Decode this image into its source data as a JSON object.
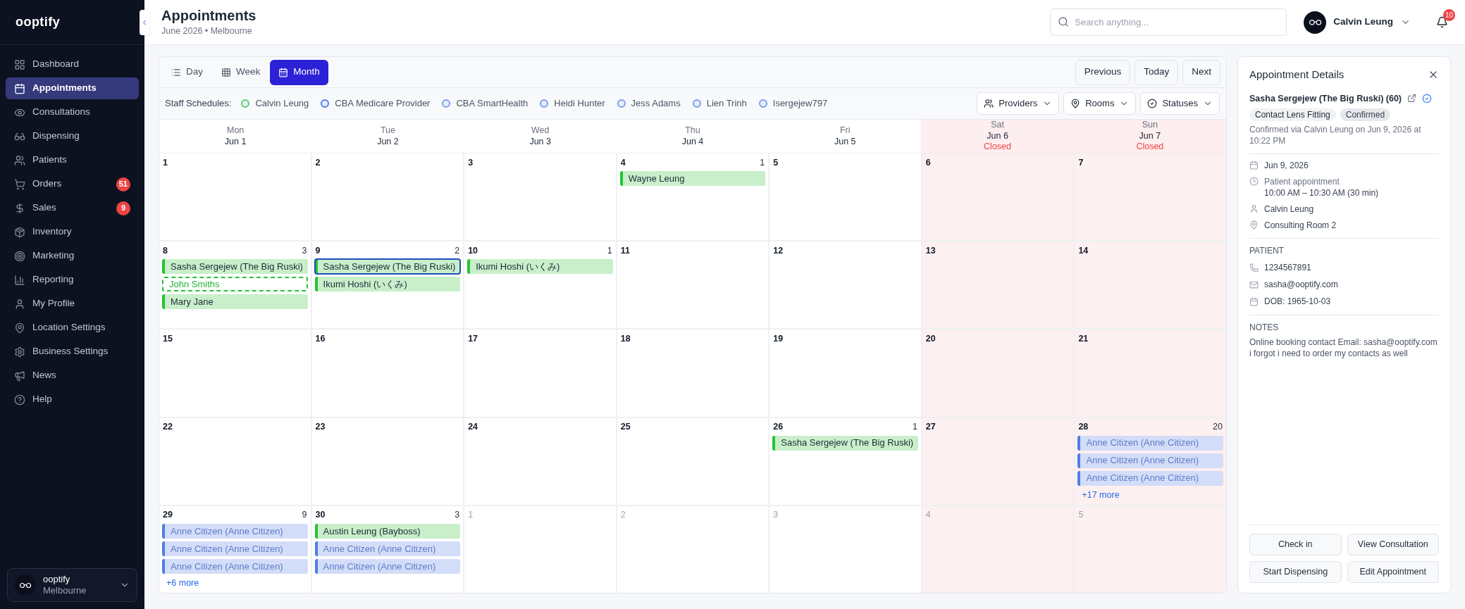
{
  "sidebar": {
    "logo": "ooptify",
    "items": [
      {
        "label": "Dashboard",
        "selected": false
      },
      {
        "label": "Appointments",
        "selected": true
      },
      {
        "label": "Consultations",
        "selected": false
      },
      {
        "label": "Dispensing",
        "selected": false
      },
      {
        "label": "Patients",
        "selected": false
      },
      {
        "label": "Orders",
        "selected": false,
        "badge": "51"
      },
      {
        "label": "Sales",
        "selected": false,
        "badge": "9"
      },
      {
        "label": "Inventory",
        "selected": false
      },
      {
        "label": "Marketing",
        "selected": false
      },
      {
        "label": "Reporting",
        "selected": false
      },
      {
        "label": "My Profile",
        "selected": false
      },
      {
        "label": "Location Settings",
        "selected": false
      },
      {
        "label": "Business Settings",
        "selected": false
      },
      {
        "label": "News",
        "selected": false
      },
      {
        "label": "Help",
        "selected": false
      }
    ],
    "account": {
      "name": "ooptify",
      "location": "Melbourne"
    }
  },
  "header": {
    "title": "Appointments",
    "subtitle": "June 2026 • Melbourne",
    "search": {
      "placeholder": "Search anything..."
    },
    "user": "Calvin Leung",
    "notifications": "10"
  },
  "calendar": {
    "views": [
      {
        "label": "Day",
        "selected": false
      },
      {
        "label": "Week",
        "selected": false
      },
      {
        "label": "Month",
        "selected": true
      }
    ],
    "nav": [
      "Previous",
      "Today",
      "Next"
    ],
    "staff_label": "Staff Schedules:",
    "staff": [
      {
        "name": "Calvin Leung",
        "color": "#5fd06a"
      },
      {
        "name": "CBA Medicare Provider",
        "color": "#4f7ee8"
      },
      {
        "name": "CBA SmartHealth",
        "color": "#7d9ef0"
      },
      {
        "name": "Heidi Hunter",
        "color": "#7d9ef0"
      },
      {
        "name": "Jess Adams",
        "color": "#7d9ef0"
      },
      {
        "name": "Lien Trinh",
        "color": "#7d9ef0"
      },
      {
        "name": "Isergejew797",
        "color": "#7d9ef0"
      }
    ],
    "filters": [
      "Providers",
      "Rooms",
      "Statuses"
    ],
    "weekdays": [
      {
        "day": "Mon",
        "date": "Jun 1",
        "closed": false
      },
      {
        "day": "Tue",
        "date": "Jun 2",
        "closed": false
      },
      {
        "day": "Wed",
        "date": "Jun 3",
        "closed": false
      },
      {
        "day": "Thu",
        "date": "Jun 4",
        "closed": false
      },
      {
        "day": "Fri",
        "date": "Jun 5",
        "closed": false
      },
      {
        "day": "Sat",
        "date": "Jun 6",
        "closed": true,
        "note": "Closed"
      },
      {
        "day": "Sun",
        "date": "Jun 7",
        "closed": true,
        "note": "Closed"
      }
    ],
    "days": [
      {
        "number": "1",
        "outside_month": false
      },
      {
        "number": "2",
        "outside_month": false
      },
      {
        "number": "3",
        "outside_month": false
      },
      {
        "number": "4",
        "outside_month": false,
        "count": "1",
        "events": [
          {
            "name": "Wayne Leung",
            "kind": "booked",
            "selected": false
          }
        ]
      },
      {
        "number": "5",
        "outside_month": false
      },
      {
        "number": "6",
        "outside_month": false
      },
      {
        "number": "7",
        "outside_month": false
      },
      {
        "number": "8",
        "outside_month": false,
        "count": "3",
        "events": [
          {
            "name": "Sasha Sergejew (The Big Ruski)",
            "kind": "booked",
            "selected": false
          },
          {
            "name": "John Smiths",
            "kind": "unconfirmed",
            "selected": false
          },
          {
            "name": "Mary Jane",
            "kind": "booked",
            "selected": false
          }
        ]
      },
      {
        "number": "9",
        "outside_month": false,
        "count": "2",
        "events": [
          {
            "name": "Sasha Sergejew (The Big Ruski)",
            "kind": "booked",
            "selected": true
          },
          {
            "name": "Ikumi Hoshi (いくみ)",
            "kind": "booked",
            "selected": false
          }
        ]
      },
      {
        "number": "10",
        "outside_month": false,
        "count": "1",
        "events": [
          {
            "name": "Ikumi Hoshi (いくみ)",
            "kind": "booked",
            "selected": false
          }
        ]
      },
      {
        "number": "11",
        "outside_month": false
      },
      {
        "number": "12",
        "outside_month": false
      },
      {
        "number": "13",
        "outside_month": false
      },
      {
        "number": "14",
        "outside_month": false
      },
      {
        "number": "15",
        "outside_month": false
      },
      {
        "number": "16",
        "outside_month": false
      },
      {
        "number": "17",
        "outside_month": false
      },
      {
        "number": "18",
        "outside_month": false
      },
      {
        "number": "19",
        "outside_month": false
      },
      {
        "number": "20",
        "outside_month": false
      },
      {
        "number": "21",
        "outside_month": false
      },
      {
        "number": "22",
        "outside_month": false
      },
      {
        "number": "23",
        "outside_month": false
      },
      {
        "number": "24",
        "outside_month": false
      },
      {
        "number": "25",
        "outside_month": false
      },
      {
        "number": "26",
        "outside_month": false,
        "count": "1",
        "events": [
          {
            "name": "Sasha Sergejew (The Big Ruski)",
            "kind": "booked",
            "selected": false
          }
        ]
      },
      {
        "number": "27",
        "outside_month": false
      },
      {
        "number": "28",
        "outside_month": false,
        "count": "20",
        "events": [
          {
            "name": "Anne Citizen (Anne Citizen)",
            "kind": "faded",
            "selected": false
          },
          {
            "name": "Anne Citizen (Anne Citizen)",
            "kind": "faded",
            "selected": false
          },
          {
            "name": "Anne Citizen (Anne Citizen)",
            "kind": "faded",
            "selected": false
          }
        ],
        "more": "+17 more"
      },
      {
        "number": "29",
        "outside_month": false,
        "count": "9",
        "events": [
          {
            "name": "Anne Citizen (Anne Citizen)",
            "kind": "faded",
            "selected": false
          },
          {
            "name": "Anne Citizen (Anne Citizen)",
            "kind": "faded",
            "selected": false
          },
          {
            "name": "Anne Citizen (Anne Citizen)",
            "kind": "faded",
            "selected": false
          }
        ],
        "more": "+6 more"
      },
      {
        "number": "30",
        "outside_month": false,
        "count": "3",
        "events": [
          {
            "name": "Austin Leung (Bayboss)",
            "kind": "booked",
            "selected": false
          },
          {
            "name": "Anne Citizen (Anne Citizen)",
            "kind": "faded",
            "selected": false
          },
          {
            "name": "Anne Citizen (Anne Citizen)",
            "kind": "faded",
            "selected": false
          }
        ]
      },
      {
        "number": "1",
        "outside_month": true
      },
      {
        "number": "2",
        "outside_month": true
      },
      {
        "number": "3",
        "outside_month": true
      },
      {
        "number": "4",
        "outside_month": true
      },
      {
        "number": "5",
        "outside_month": true
      }
    ]
  },
  "details": {
    "title": "Appointment Details",
    "patient_name": "Sasha Sergejew (The Big Ruski) (60)",
    "tags": [
      "Contact Lens Fitting",
      "Confirmed"
    ],
    "confirmation": "Confirmed via Calvin Leung on Jun 9, 2026 at 10:22 PM",
    "rows": [
      {
        "kind": "date",
        "lines": [
          "Jun 9, 2026"
        ]
      },
      {
        "kind": "time",
        "lines": [
          "Patient appointment",
          "10:00 AM – 10:30 AM (30 min)"
        ]
      },
      {
        "kind": "person",
        "lines": [
          "Calvin Leung"
        ]
      },
      {
        "kind": "location",
        "lines": [
          "Consulting Room 2"
        ]
      }
    ],
    "patient_heading": "PATIENT",
    "patient_rows": [
      {
        "kind": "phone",
        "text": "1234567891"
      },
      {
        "kind": "email",
        "text": "sasha@ooptify.com"
      },
      {
        "kind": "date",
        "text": "DOB: 1965-10-03"
      }
    ],
    "notes_heading": "NOTES",
    "notes": "Online booking contact Email: sasha@ooptify.com i forgot i need to order my contacts as well",
    "actions": [
      "Check in",
      "View Consultation",
      "Start Dispensing",
      "Edit Appointment"
    ]
  }
}
